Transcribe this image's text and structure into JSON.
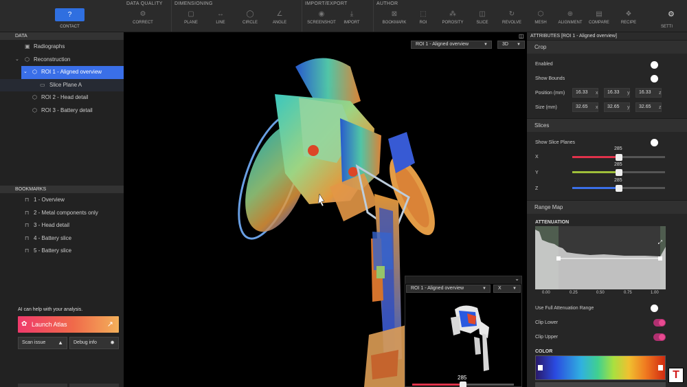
{
  "toolbar": {
    "contact": "CONTACT",
    "groups": [
      {
        "label": "DATA QUALITY",
        "buttons": [
          "CORRECT"
        ]
      },
      {
        "label": "DIMENSIONING",
        "buttons": [
          "PLANE",
          "LINE",
          "CIRCLE",
          "ANGLE"
        ]
      },
      {
        "label": "IMPORT/EXPORT",
        "buttons": [
          "SCREENSHOT",
          "IMPORT"
        ]
      },
      {
        "label": "AUTHOR",
        "buttons": [
          "BOOKMARK",
          "ROI",
          "POROSITY",
          "SLICE",
          "REVOLVE",
          "MESH",
          "ALIGNMENT",
          "COMPARE",
          "RECIPE"
        ]
      }
    ],
    "settings": "SETTI"
  },
  "data_panel": {
    "header": "DATA",
    "items": [
      {
        "label": "Radiographs"
      },
      {
        "label": "Reconstruction"
      },
      {
        "label": "ROI 1 - Aligned overview"
      },
      {
        "label": "Slice Plane A"
      },
      {
        "label": "ROI 2 - Head detail"
      },
      {
        "label": "ROI 3 - Battery detail"
      }
    ]
  },
  "bookmarks_panel": {
    "header": "BOOKMARKS",
    "items": [
      "1 - Overview",
      "2 - Metal components only",
      "3 - Head detail",
      "4 - Battery slice",
      "5 - Battery slice"
    ]
  },
  "ai": {
    "prompt": "AI can help with your analysis.",
    "launch": "Launch Atlas",
    "scan": "Scan issue",
    "debug": "Debug info"
  },
  "viewport": {
    "view_select": "ROI 1 - Aligned overview",
    "mode_select": "3D",
    "inset_select": "ROI 1 - Aligned overview",
    "inset_axis": "X",
    "inset_slider_value": "285",
    "inset_slider_fraction": 0.5
  },
  "attributes": {
    "title": "ATTRIBUTES [ROI 1 - Aligned overview]",
    "crop": {
      "header": "Crop",
      "enabled": "Enabled",
      "show_bounds": "Show Bounds",
      "position_label": "Position (mm)",
      "size_label": "Size (mm)",
      "position": [
        "16.33",
        "16.33",
        "16.33"
      ],
      "size": [
        "32.65",
        "32.65",
        "32.65"
      ],
      "axes": [
        "x",
        "y",
        "z"
      ]
    },
    "slices": {
      "header": "Slices",
      "show": "Show Slice Planes",
      "axes": [
        {
          "label": "X",
          "value": "285",
          "fraction": 0.5,
          "color": "#e0324a"
        },
        {
          "label": "Y",
          "value": "285",
          "fraction": 0.5,
          "color": "#9fbf3a"
        },
        {
          "label": "Z",
          "value": "285",
          "fraction": 0.5,
          "color": "#3a6fe8"
        }
      ]
    },
    "range": {
      "header": "Range Map",
      "attenuation": "ATTENUATION",
      "ticks": [
        "0.00",
        "0.25",
        "0.50",
        "0.75",
        "1.00"
      ],
      "use_full": "Use Full Attenuation Range",
      "clip_lower": "Clip Lower",
      "clip_upper": "Clip Upper",
      "color": "COLOR"
    }
  },
  "colors": {
    "accent": "#3a6fe8",
    "atlas_start": "#ef3a6b",
    "atlas_end": "#f3b05a",
    "toggle_pink": "#e84a90"
  }
}
